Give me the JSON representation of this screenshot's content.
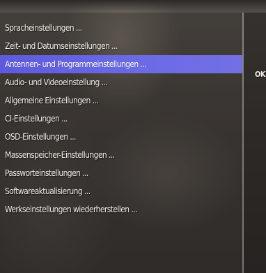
{
  "menu": {
    "items": [
      {
        "label": "Spracheinstellungen ..."
      },
      {
        "label": "Zeit- und Datumseinstellungen ..."
      },
      {
        "label": "Antennen- und Programmeinstellungen ..."
      },
      {
        "label": "Audio- und Videoeinstellung ..."
      },
      {
        "label": "Allgemeine Einstellungen ..."
      },
      {
        "label": "CI-Einstellungen ..."
      },
      {
        "label": "OSD-Einstellungen ..."
      },
      {
        "label": "Massenspeicher-Einstellungen ..."
      },
      {
        "label": "Passworteinstellungen ..."
      },
      {
        "label": "Softwareaktualisierung ..."
      },
      {
        "label": "Werkseinstellungen wiederherstellen ..."
      }
    ],
    "selected_index": 2
  },
  "side": {
    "ok_label": "OK"
  },
  "colors": {
    "highlight": "#6663e3",
    "text": "#f1efe9",
    "background": "#4a4540"
  }
}
